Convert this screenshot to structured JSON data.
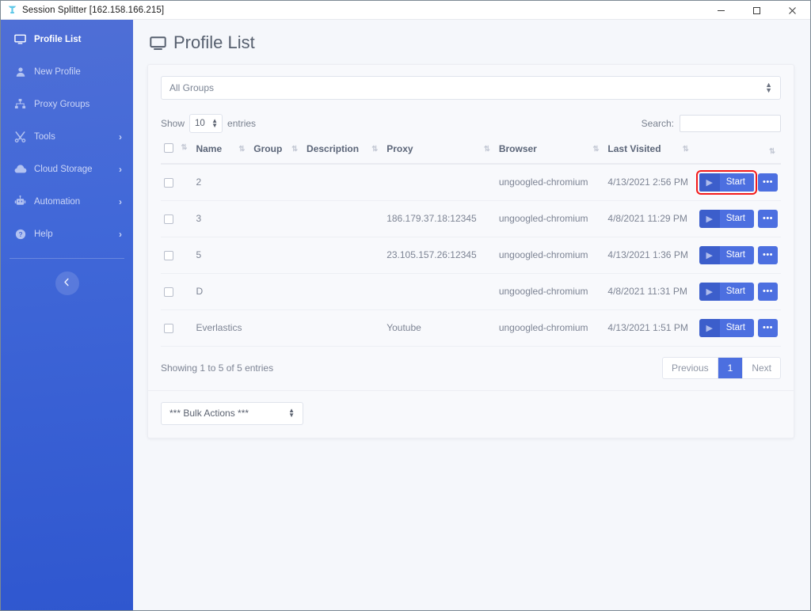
{
  "window": {
    "title": "Session Splitter [162.158.166.215]",
    "app_icon": "session-splitter-logo",
    "minimize": "─",
    "maximize": "□",
    "close": "✕"
  },
  "sidebar": {
    "items": [
      {
        "label": "Profile List",
        "icon": "monitor-icon",
        "active": true,
        "chevron": ""
      },
      {
        "label": "New Profile",
        "icon": "user-icon",
        "active": false,
        "chevron": ""
      },
      {
        "label": "Proxy Groups",
        "icon": "sitemap-icon",
        "active": false,
        "chevron": ""
      },
      {
        "label": "Tools",
        "icon": "tools-icon",
        "active": false,
        "chevron": "›"
      },
      {
        "label": "Cloud Storage",
        "icon": "cloud-icon",
        "active": false,
        "chevron": "›"
      },
      {
        "label": "Automation",
        "icon": "robot-icon",
        "active": false,
        "chevron": "›"
      },
      {
        "label": "Help",
        "icon": "question-circle-icon",
        "active": false,
        "chevron": "›"
      }
    ],
    "collapse_icon": "chevron-left-icon"
  },
  "page": {
    "title": "Profile List",
    "title_icon": "monitor-icon"
  },
  "filters": {
    "group_select_value": "All Groups"
  },
  "table_controls": {
    "show_label": "Show",
    "entries_value": "10",
    "entries_label": "entries",
    "search_label": "Search:",
    "search_value": "",
    "search_placeholder": ""
  },
  "table": {
    "columns": [
      {
        "key": "check",
        "label": "",
        "sortable": true
      },
      {
        "key": "name",
        "label": "Name",
        "sortable": true
      },
      {
        "key": "group",
        "label": "Group",
        "sortable": true
      },
      {
        "key": "description",
        "label": "Description",
        "sortable": true
      },
      {
        "key": "proxy",
        "label": "Proxy",
        "sortable": true
      },
      {
        "key": "browser",
        "label": "Browser",
        "sortable": true
      },
      {
        "key": "last_visited",
        "label": "Last Visited",
        "sortable": true
      },
      {
        "key": "actions",
        "label": "",
        "sortable": true
      }
    ],
    "sort_icon": "⇅",
    "rows": [
      {
        "checked": false,
        "name": "2",
        "group": "",
        "description": "",
        "proxy": "",
        "browser": "ungoogled-chromium",
        "last_visited": "4/13/2021 2:56 PM",
        "start_label": "Start",
        "highlight": true
      },
      {
        "checked": false,
        "name": "3",
        "group": "",
        "description": "",
        "proxy": "186.179.37.18:12345",
        "browser": "ungoogled-chromium",
        "last_visited": "4/8/2021 11:29 PM",
        "start_label": "Start",
        "highlight": false
      },
      {
        "checked": false,
        "name": "5",
        "group": "",
        "description": "",
        "proxy": "23.105.157.26:12345",
        "browser": "ungoogled-chromium",
        "last_visited": "4/13/2021 1:36 PM",
        "start_label": "Start",
        "highlight": false
      },
      {
        "checked": false,
        "name": "D",
        "group": "",
        "description": "",
        "proxy": "",
        "browser": "ungoogled-chromium",
        "last_visited": "4/8/2021 11:31 PM",
        "start_label": "Start",
        "highlight": false
      },
      {
        "checked": false,
        "name": "Everlastics",
        "group": "",
        "description": "",
        "proxy": "Youtube",
        "browser": "ungoogled-chromium",
        "last_visited": "4/13/2021 1:51 PM",
        "start_label": "Start",
        "highlight": false
      }
    ],
    "more_label": "•••",
    "play_glyph": "▶"
  },
  "footer": {
    "info": "Showing 1 to 5 of 5 entries",
    "pagination": {
      "previous": "Previous",
      "pages": [
        "1"
      ],
      "current": "1",
      "next": "Next"
    }
  },
  "bulk": {
    "value": "*** Bulk Actions ***"
  },
  "colors": {
    "sidebar_top": "#4f6fd6",
    "sidebar_bottom": "#2f57cf",
    "accent": "#4c6fe0",
    "accent_dark": "#3c5ecb",
    "highlight_outline": "#f31b1b",
    "page_bg": "#f5f7fb",
    "card_bg": "#f8f9fc",
    "text_muted": "#7d8494"
  }
}
